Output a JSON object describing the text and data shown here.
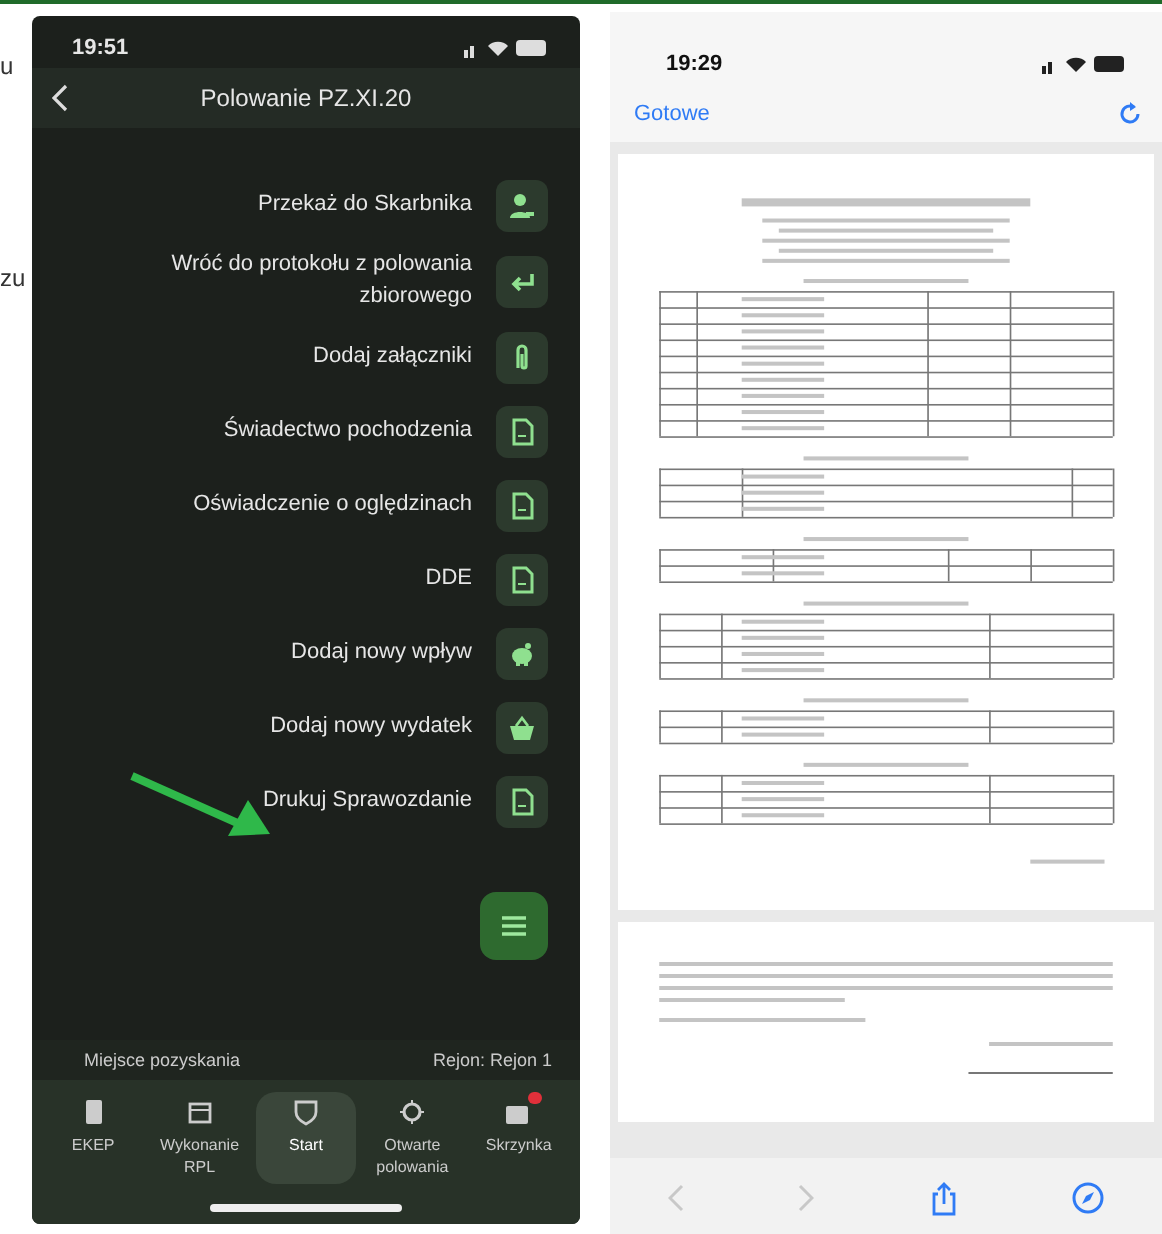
{
  "background_fragments": [
    "u",
    "zu"
  ],
  "app": {
    "status_time": "19:51",
    "title": "Polowanie PZ.XI.20",
    "menu": [
      {
        "label": "Przekaż do Skarbnika",
        "kind": "person"
      },
      {
        "label": "Wróć do protokołu z polowania zbiorowego",
        "kind": "return"
      },
      {
        "label": "Dodaj załączniki",
        "kind": "clip"
      },
      {
        "label": "Świadectwo pochodzenia",
        "kind": "doc"
      },
      {
        "label": "Oświadczenie o oględzinach",
        "kind": "doc"
      },
      {
        "label": "DDE",
        "kind": "doc"
      },
      {
        "label": "Dodaj nowy wpływ",
        "kind": "piggy"
      },
      {
        "label": "Dodaj nowy wydatek",
        "kind": "basket"
      },
      {
        "label": "Drukuj Sprawozdanie",
        "kind": "doc"
      }
    ],
    "info_bar": {
      "left": "Miejsce pozyskania",
      "right": "Rejon: Rejon 1"
    },
    "tabs": [
      {
        "label": "EKEP",
        "kind": "book",
        "selected": false,
        "badge": false
      },
      {
        "label": "Wykonanie RPL",
        "kind": "calendar",
        "selected": false,
        "badge": false
      },
      {
        "label": "Start",
        "kind": "shield",
        "selected": true,
        "badge": false
      },
      {
        "label": "Otwarte polowania",
        "kind": "target",
        "selected": false,
        "badge": false
      },
      {
        "label": "Skrzynka",
        "kind": "inbox",
        "selected": false,
        "badge": true
      }
    ]
  },
  "viewer": {
    "status_time": "19:29",
    "done": "Gotowe"
  }
}
